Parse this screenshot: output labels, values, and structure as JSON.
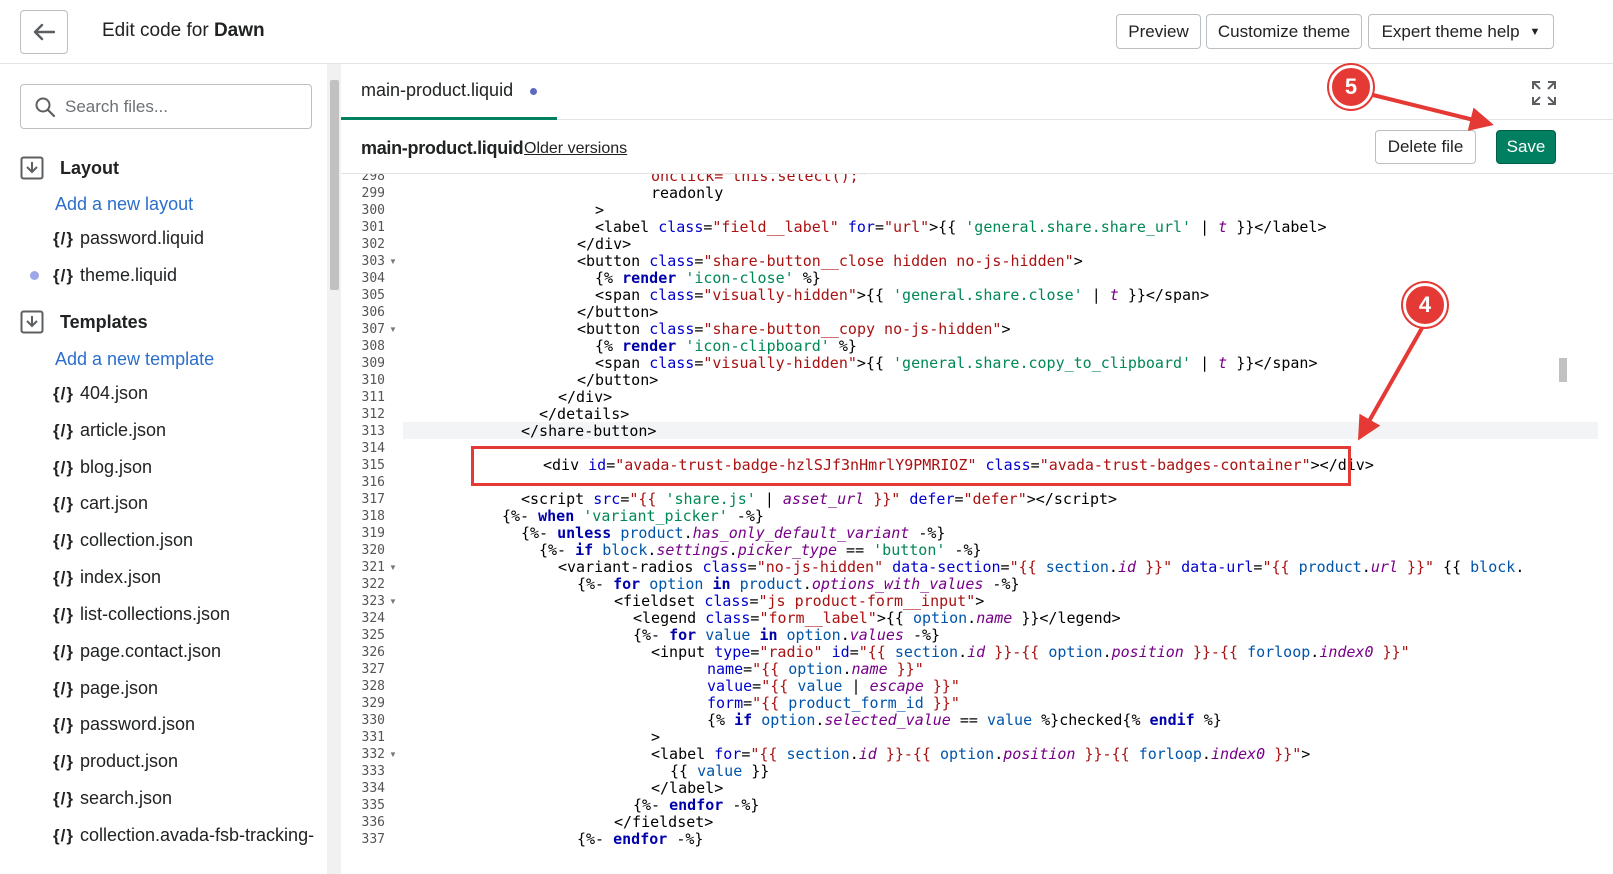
{
  "topbar": {
    "title_prefix": "Edit code for ",
    "title_theme": "Dawn",
    "preview_label": "Preview",
    "customize_label": "Customize theme",
    "expert_label": "Expert theme help"
  },
  "sidebar": {
    "search_placeholder": "Search files...",
    "layout_title": "Layout",
    "add_layout": "Add a new layout",
    "layout_files": [
      "password.liquid",
      "theme.liquid"
    ],
    "templates_title": "Templates",
    "add_template": "Add a new template",
    "template_files": [
      "404.json",
      "article.json",
      "blog.json",
      "cart.json",
      "collection.json",
      "index.json",
      "list-collections.json",
      "page.contact.json",
      "page.json",
      "password.json",
      "product.json",
      "search.json",
      "collection.avada-fsb-tracking-"
    ],
    "file_icon": "{/}"
  },
  "editor": {
    "tab_label": "main-product.liquid",
    "file_name": "main-product.liquid",
    "older_versions": "Older versions",
    "delete_label": "Delete file",
    "save_label": "Save"
  },
  "code": {
    "line_numbers": [
      "298",
      "299",
      "300",
      "301",
      "302",
      "303",
      "304",
      "305",
      "306",
      "307",
      "308",
      "309",
      "310",
      "311",
      "312",
      "313",
      "314",
      "315",
      "316",
      "317",
      "318",
      "319",
      "320",
      "321",
      "322",
      "323",
      "324",
      "325",
      "326",
      "327",
      "328",
      "329",
      "330",
      "331",
      "332",
      "333",
      "334",
      "335",
      "336",
      "337"
    ],
    "fold_lines": [
      "303",
      "307",
      "321",
      "323",
      "332"
    ]
  },
  "annotations": {
    "marker_4": "4",
    "marker_5": "5",
    "color": "#e53935"
  }
}
